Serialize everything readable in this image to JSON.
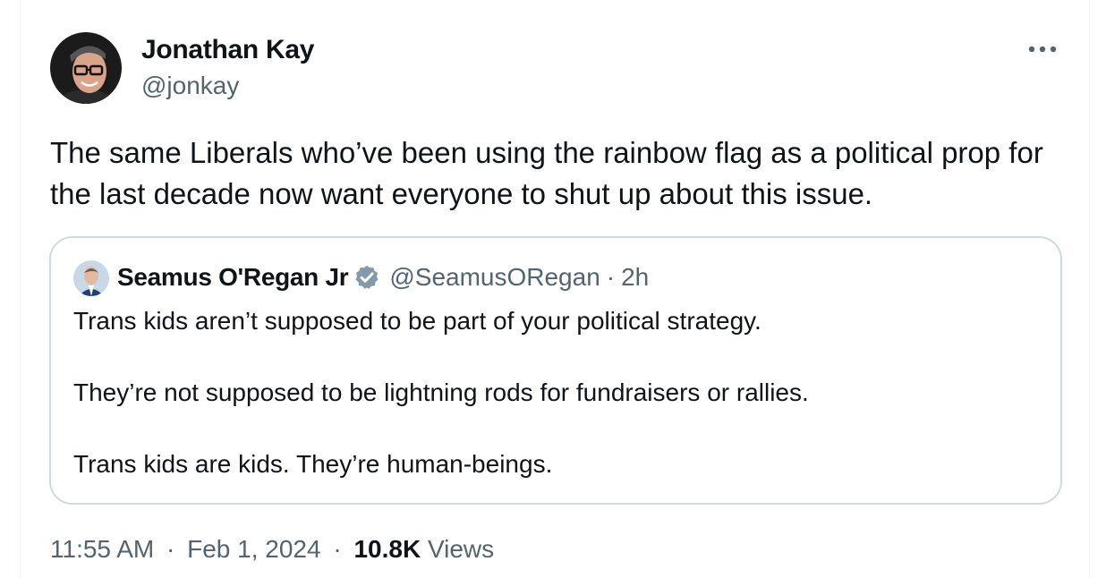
{
  "tweet": {
    "author": {
      "name": "Jonathan Kay",
      "handle": "@jonkay"
    },
    "text": "The same Liberals who’ve been using the rainbow flag as a political prop for the last decade now want everyone to shut up about this issue.",
    "quote": {
      "name": "Seamus O'Regan Jr",
      "handle": "@SeamusORegan",
      "separator": "·",
      "time": "2h",
      "lines": [
        "Trans kids aren’t supposed to be part of your political strategy.",
        "They’re not supposed to be lightning rods for fundraisers or rallies.",
        "Trans kids are kids. They’re human-beings."
      ]
    },
    "meta": {
      "time": "11:55 AM",
      "separator": "·",
      "date": "Feb 1, 2024",
      "views_count": "10.8K",
      "views_label": "Views"
    }
  },
  "icons": {
    "more": "more-horizontal-icon",
    "verified": "verified-badge-icon"
  },
  "colors": {
    "primary_text": "#0f1419",
    "secondary_text": "#536471",
    "border": "#cfd9de",
    "verified_badge": "#829aab"
  }
}
